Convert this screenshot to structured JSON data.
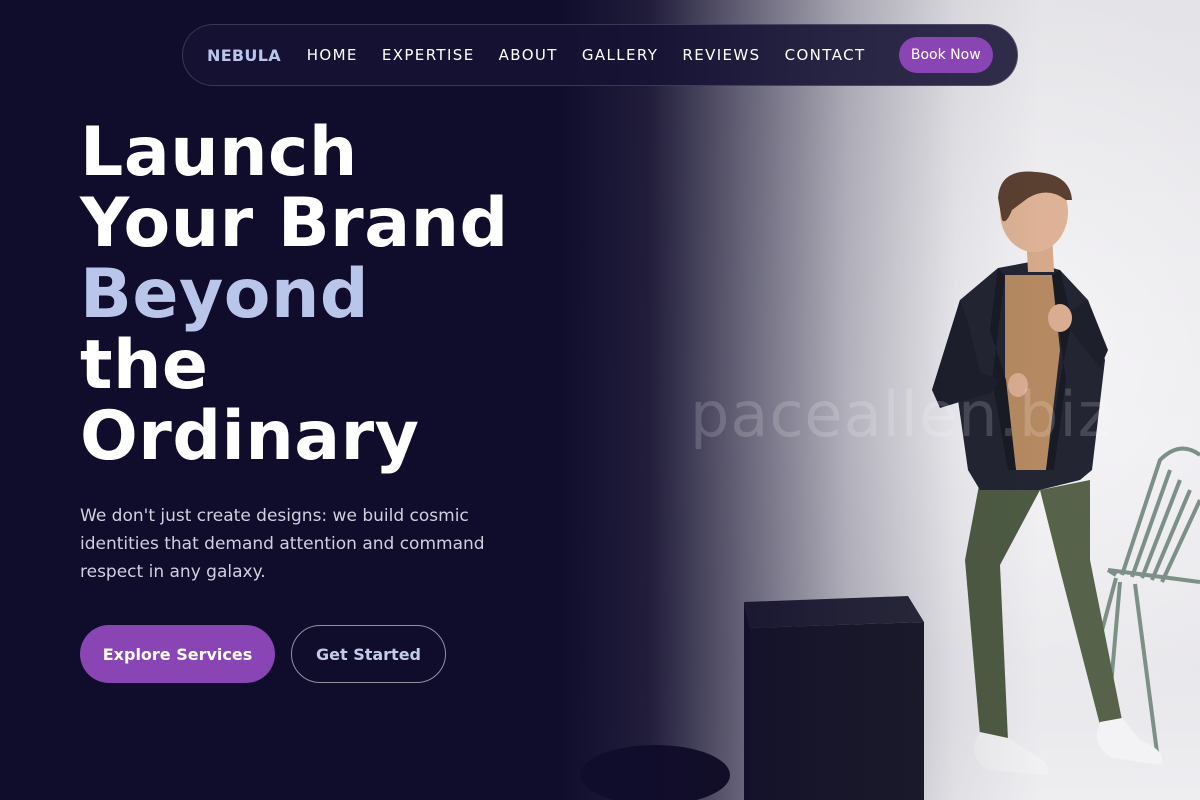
{
  "nav": {
    "brand": "NEBULA",
    "links": [
      "HOME",
      "EXPERTISE",
      "ABOUT",
      "GALLERY",
      "REVIEWS",
      "CONTACT"
    ],
    "cta": "Book Now"
  },
  "hero": {
    "headline_lines": [
      "Launch",
      "Your Brand",
      "Beyond",
      "the",
      "Ordinary"
    ],
    "subtitle": "We don't just create designs: we build cosmic identities that demand attention and command respect in any galaxy.",
    "primary_button": "Explore Services",
    "secondary_button": "Get Started",
    "watermark": "paceallen.biz"
  },
  "colors": {
    "background": "#100c2c",
    "accent": "#8a45b4",
    "headline_highlight": "#b9c6e9"
  }
}
